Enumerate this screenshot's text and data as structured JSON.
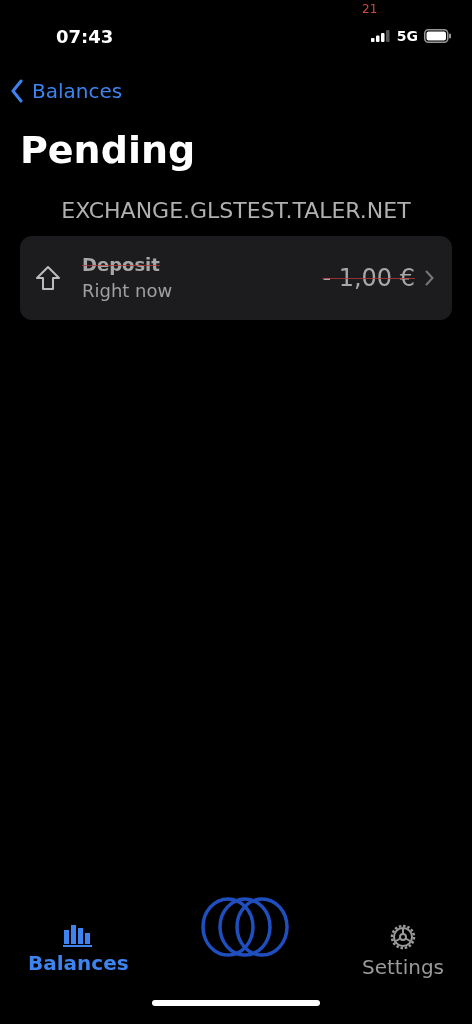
{
  "status_bar": {
    "time": "07:43",
    "counter": "21",
    "network": "5G"
  },
  "nav": {
    "back_label": "Balances"
  },
  "title": "Pending",
  "section": "EXCHANGE.GLSTEST.TALER.NET",
  "transactions": [
    {
      "kind": "deposit",
      "title": "Deposit",
      "subtitle": "Right now",
      "amount": "- 1,00 €",
      "struck": true
    }
  ],
  "tabs": [
    {
      "kind": "balances",
      "label": "Balances",
      "selected": true
    },
    {
      "kind": "logo"
    },
    {
      "kind": "settings",
      "label": "Settings",
      "selected": false
    }
  ]
}
